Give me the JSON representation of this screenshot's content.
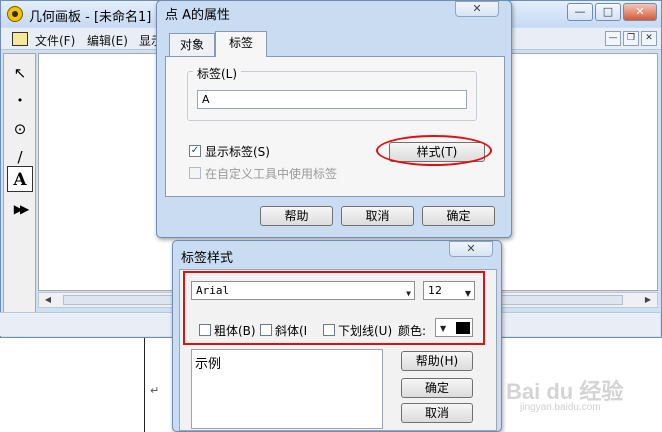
{
  "app": {
    "title": "几何画板 - [未命名1]",
    "menu": [
      "文件(F)",
      "编辑(E)",
      "显示"
    ],
    "window_controls": [
      "—",
      "□",
      "✕"
    ],
    "doc_controls": [
      "—",
      "❐",
      "✕"
    ]
  },
  "toolbox": {
    "tools": [
      {
        "icon": "arrow-select-icon",
        "glyph": "↖"
      },
      {
        "icon": "point-tool-icon",
        "glyph": "•"
      },
      {
        "icon": "compass-tool-icon",
        "glyph": "⊙"
      },
      {
        "icon": "line-tool-icon",
        "glyph": "/"
      },
      {
        "icon": "text-tool-icon",
        "glyph": "A"
      },
      {
        "icon": "custom-tool-icon",
        "glyph": "▶▶"
      }
    ]
  },
  "props_dialog": {
    "title": "点 A的属性",
    "close": "✕",
    "tabs": [
      "对象",
      "标签"
    ],
    "active_tab": "标签",
    "label_group_title": "标签(L)",
    "label_value": "A",
    "show_label": {
      "text": "显示标签(S)",
      "checked": true,
      "mark": "✓"
    },
    "custom_tool_label": {
      "text": "在自定义工具中使用标签",
      "checked": false,
      "disabled": true
    },
    "style_button": "样式(T)",
    "buttons": {
      "help": "帮助",
      "cancel": "取消",
      "ok": "确定"
    }
  },
  "style_dialog": {
    "title": "标签样式",
    "close": "✕",
    "font": "Arial",
    "size": "12",
    "dropdown_arrow": "▼",
    "bold": "粗体(B)",
    "italic": "斜体(I",
    "underline": "下划线(U)",
    "color_label": "颜色:",
    "color_value": "#000000",
    "sample_text": "示例",
    "buttons": {
      "help": "帮助(H)",
      "ok": "确定",
      "cancel": "取消"
    }
  },
  "background_doc": {
    "return_mark": "↵",
    "watermark": "Bai du 经验",
    "watermark_url": "jingyan.baidu.com"
  },
  "colors": {
    "highlight": "#e01010",
    "dialog_frame": "#c9dcf2"
  }
}
